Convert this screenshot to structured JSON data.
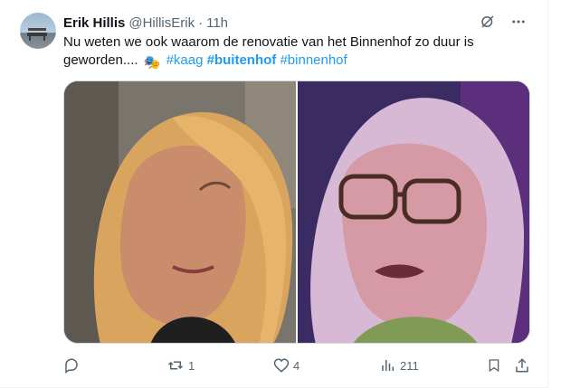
{
  "tweet": {
    "author": {
      "name": "Erik Hillis",
      "handle": "@HillisErik",
      "separator": "·",
      "time": "11h"
    },
    "text": {
      "body": "Nu weten we ook waarom de renovatie van het Binnenhof zo duur is geworden.... ",
      "emoji": "🎭",
      "hashtags": [
        "#kaag",
        "#buitenhof",
        "#binnenhof"
      ]
    },
    "media": [
      {
        "alt": "Photo of woman with blonde hair, profile view"
      },
      {
        "alt": "Photo of woman with blonde hair and glasses"
      }
    ],
    "stats": {
      "replies": "",
      "reposts": "1",
      "likes": "4",
      "views": "211"
    }
  },
  "colors": {
    "accent": "#1d9bf0",
    "secondary_text": "#536471",
    "primary_text": "#0f1419"
  },
  "icons": {
    "grok": "grok-icon",
    "more": "more-icon",
    "reply": "reply-icon",
    "repost": "repost-icon",
    "like": "like-icon",
    "views": "views-icon",
    "bookmark": "bookmark-icon",
    "share": "share-icon"
  }
}
